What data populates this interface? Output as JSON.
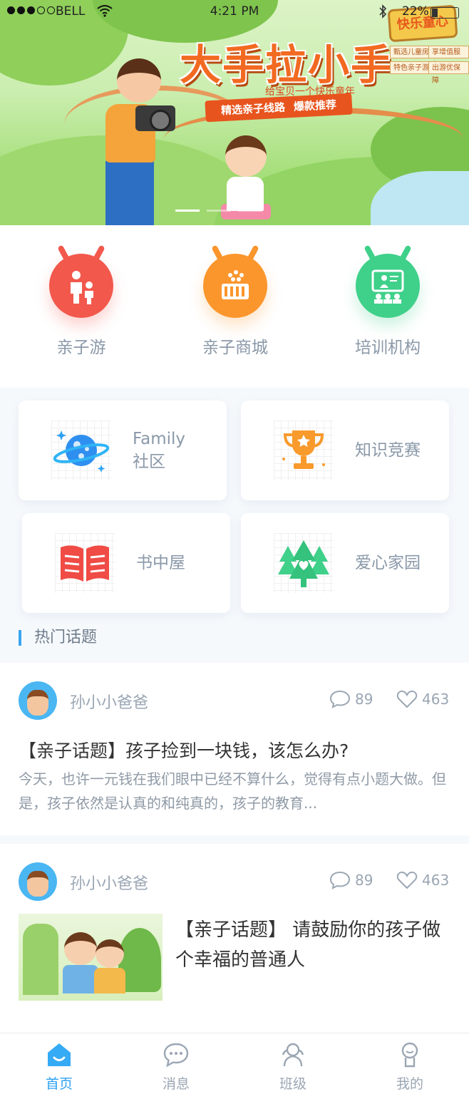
{
  "status_bar": {
    "carrier": "BELL",
    "time": "4:21 PM",
    "battery": "22%"
  },
  "banner": {
    "title": "大手拉小手",
    "subtitle": "给宝贝一个快乐童年",
    "ribbon_left": "精选亲子线路",
    "ribbon_right": "爆款推荐",
    "badge": "快乐童心",
    "tags": [
      "甄选儿童房",
      "享增值服务",
      "特色亲子游",
      "出游优保障"
    ],
    "carousel_active_index": 0,
    "carousel_count": 3
  },
  "categories": [
    {
      "label": "亲子游",
      "icon": "family-icon",
      "color": "#f2584c"
    },
    {
      "label": "亲子商城",
      "icon": "shopping-basket-icon",
      "color": "#fb962c"
    },
    {
      "label": "培训机构",
      "icon": "classroom-icon",
      "color": "#3fd08a"
    }
  ],
  "cards": [
    {
      "line1": "Family",
      "line2": "社区",
      "icon": "planet-icon"
    },
    {
      "line1": "知识竞赛",
      "line2": "",
      "icon": "trophy-icon"
    },
    {
      "line1": "书中屋",
      "line2": "",
      "icon": "book-icon"
    },
    {
      "line1": "爱心家园",
      "line2": "",
      "icon": "trees-heart-icon"
    }
  ],
  "section_title": "热门话题",
  "posts": [
    {
      "user": "孙小小爸爸",
      "comments": "89",
      "likes": "463",
      "title": "【亲子话题】孩子捡到一块钱，该怎么办?",
      "body": "今天，也许一元钱在我们眼中已经不算什么，觉得有点小题大做。但是，孩子依然是认真的和纯真的，孩子的教育..."
    },
    {
      "user": "孙小小爸爸",
      "comments": "89",
      "likes": "463",
      "title": "【亲子话题】 请鼓励你的孩子做个幸福的普通人"
    }
  ],
  "tabs": [
    {
      "label": "首页",
      "icon": "home-icon",
      "active": true
    },
    {
      "label": "消息",
      "icon": "message-icon",
      "active": false
    },
    {
      "label": "班级",
      "icon": "class-icon",
      "active": false
    },
    {
      "label": "我的",
      "icon": "profile-icon",
      "active": false
    }
  ],
  "colors": {
    "accent": "#2fa2f3",
    "text_muted": "#9aa6b3"
  }
}
